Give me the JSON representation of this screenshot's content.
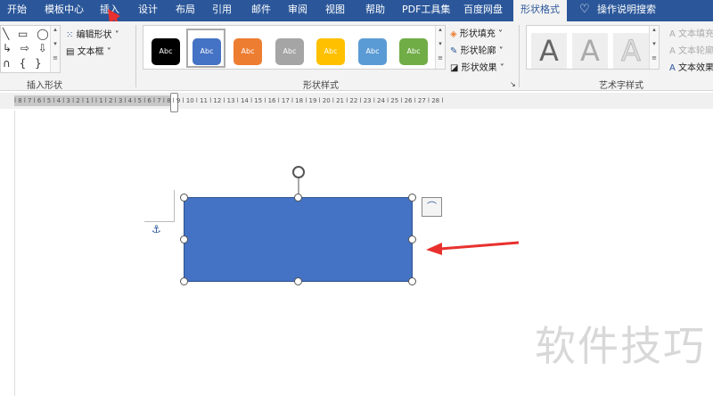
{
  "tabs": [
    "开始",
    "模板中心",
    "插入",
    "设计",
    "布局",
    "引用",
    "邮件",
    "审阅",
    "视图",
    "帮助",
    "PDF工具集",
    "百度网盘",
    "形状格式"
  ],
  "active_tab": "形状格式",
  "search": "操作说明搜索",
  "insert_shapes": {
    "edit_shape": "编辑形状",
    "text_box": "文本框",
    "label": "插入形状"
  },
  "shape_styles": {
    "preset_label": "Abc",
    "presets": [
      "#000000",
      "#4472c4",
      "#ed7d31",
      "#a5a5a5",
      "#ffc000",
      "#5b9bd5",
      "#70ad47"
    ],
    "fill": "形状填充",
    "outline": "形状轮廓",
    "effects": "形状效果",
    "label": "形状样式"
  },
  "wordart": {
    "letter": "A",
    "text_fill": "文本填充",
    "text_outline": "文本轮廓",
    "text_effects": "文本效果",
    "label": "艺术字样式"
  },
  "ruler": "l 8 l 7 l 6 l 5 l 4 l 3 l 2 l 1 l   l 1 l 2 l 3 l 4 l 5 l 6 l 7 l 8 l 9 l 10 l 11 l 12 l 13 l 14 l 15 l 16 l 17 l 18 l 19 l 20 l 21 l 22 l 23 l 24 l 25 l 26 l 27 l 28 l",
  "watermark": "软件技巧",
  "shape_fill": "#4472c4",
  "arrow_color": "#e8312f"
}
